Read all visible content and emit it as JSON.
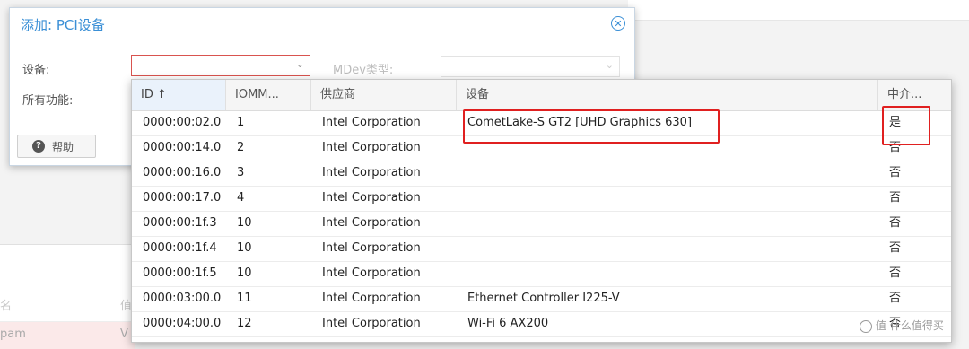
{
  "dialog": {
    "title": "添加: PCI设备",
    "device_label": "设备:",
    "all_functions_label": "所有功能:",
    "mdev_type_label": "MDev类型:",
    "help_label": "帮助",
    "accent_color": "#3a8fd6"
  },
  "background": {
    "col1": "名",
    "col2": "值",
    "row_name": "pam",
    "row_value": "V"
  },
  "table": {
    "headers": [
      "ID ↑",
      "IOMM...",
      "供应商",
      "设备",
      "中介..."
    ],
    "rows": [
      {
        "id": "0000:00:02.0",
        "iommu": "1",
        "vendor": "Intel Corporation",
        "device": "CometLake-S GT2 [UHD Graphics 630]",
        "mdev": "是"
      },
      {
        "id": "0000:00:14.0",
        "iommu": "2",
        "vendor": "Intel Corporation",
        "device": "",
        "mdev": "否"
      },
      {
        "id": "0000:00:16.0",
        "iommu": "3",
        "vendor": "Intel Corporation",
        "device": "",
        "mdev": "否"
      },
      {
        "id": "0000:00:17.0",
        "iommu": "4",
        "vendor": "Intel Corporation",
        "device": "",
        "mdev": "否"
      },
      {
        "id": "0000:00:1f.3",
        "iommu": "10",
        "vendor": "Intel Corporation",
        "device": "",
        "mdev": "否"
      },
      {
        "id": "0000:00:1f.4",
        "iommu": "10",
        "vendor": "Intel Corporation",
        "device": "",
        "mdev": "否"
      },
      {
        "id": "0000:00:1f.5",
        "iommu": "10",
        "vendor": "Intel Corporation",
        "device": "",
        "mdev": "否"
      },
      {
        "id": "0000:03:00.0",
        "iommu": "11",
        "vendor": "Intel Corporation",
        "device": "Ethernet Controller I225-V",
        "mdev": "否"
      },
      {
        "id": "0000:04:00.0",
        "iommu": "12",
        "vendor": "Intel Corporation",
        "device": "Wi-Fi 6 AX200",
        "mdev": "否"
      }
    ]
  },
  "watermark": "值 什么值得买",
  "highlight_color": "#e02020"
}
